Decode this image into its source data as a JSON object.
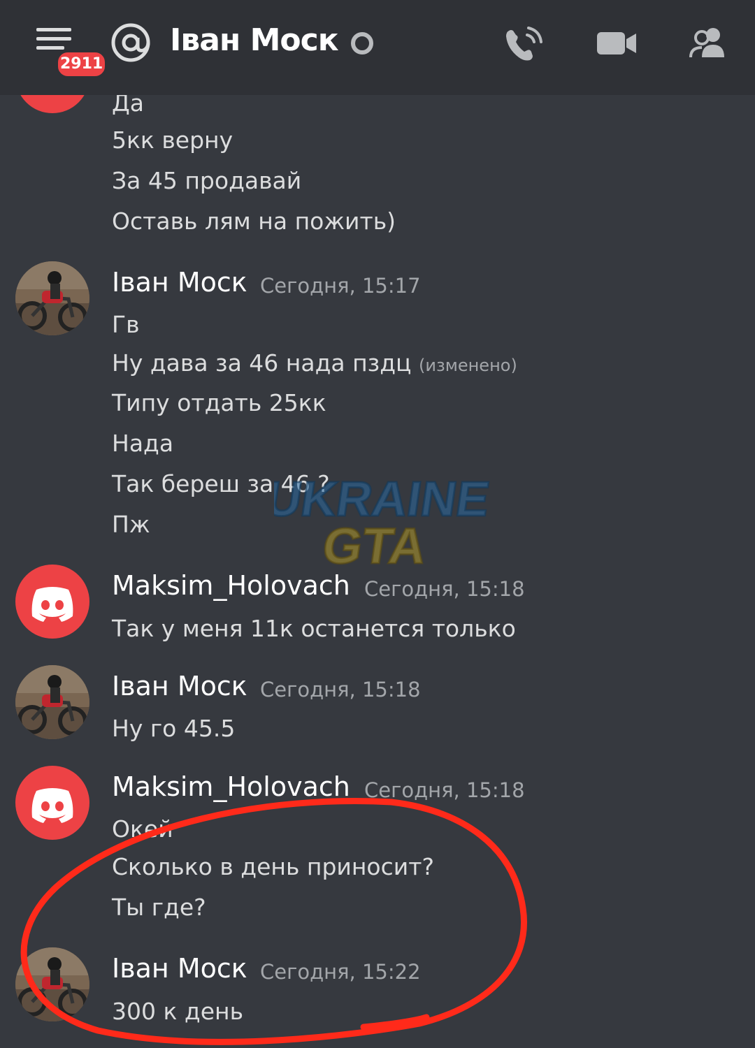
{
  "header": {
    "title": "Іван Моск",
    "unread_badge": "2911",
    "icons": [
      "hamburger-menu-icon",
      "at-icon",
      "status-icon",
      "phone-call-icon",
      "video-camera-icon",
      "members-icon"
    ]
  },
  "messages": [
    {
      "lines": [
        "Да",
        "5кк верну",
        "За 45 продавай",
        "Оставь лям на пожить)"
      ]
    },
    {
      "author": "Іван Моск",
      "time": "Сегодня, 15:17",
      "lines": [
        "Гв",
        "Ну дава за 46 нада пздц",
        "Типу отдать 25кк",
        "Нада",
        "Так береш за 46 ?",
        "Пж"
      ],
      "edited_label": "(изменено)"
    },
    {
      "author": "Maksim_Holovach",
      "time": "Сегодня, 15:18",
      "lines": [
        "Так у меня 11к останется только"
      ]
    },
    {
      "author": "Іван Моск",
      "time": "Сегодня, 15:18",
      "lines": [
        "Ну го 45.5"
      ]
    },
    {
      "author": "Maksim_Holovach",
      "time": "Сегодня, 15:18",
      "lines": [
        "Окей",
        "Сколько в день приносит?",
        "Ты где?"
      ]
    },
    {
      "author": "Іван Моск",
      "time": "Сегодня, 15:22",
      "lines": [
        "300 к день"
      ]
    }
  ],
  "watermark": {
    "line1": "UKRAINE",
    "line2": "GTA"
  },
  "colors": {
    "background": "#36393f",
    "header": "#2f3136",
    "discord_red": "#ed4245",
    "highlight_circle": "#ff2a1a"
  }
}
